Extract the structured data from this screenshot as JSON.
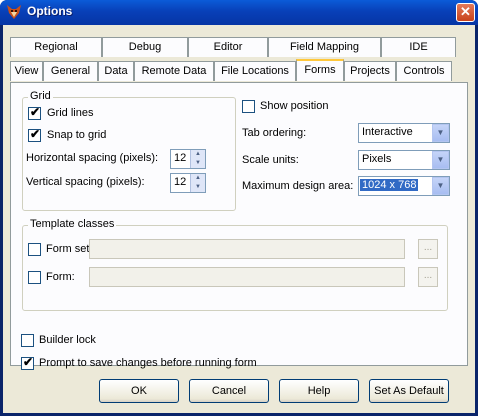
{
  "window": {
    "title": "Options",
    "close_glyph": "✕"
  },
  "tabs_row1": [
    "Regional",
    "Debug",
    "Editor",
    "Field Mapping",
    "IDE"
  ],
  "tabs_row2": [
    "View",
    "General",
    "Data",
    "Remote Data",
    "File Locations",
    "Forms",
    "Projects",
    "Controls"
  ],
  "active_tab": "Forms",
  "grid": {
    "label": "Grid",
    "grid_lines": {
      "label": "Grid lines",
      "checked": true
    },
    "snap_to_grid": {
      "label": "Snap to grid",
      "checked": true
    },
    "h_spacing": {
      "label": "Horizontal spacing (pixels):",
      "value": "12"
    },
    "v_spacing": {
      "label": "Vertical spacing (pixels):",
      "value": "12"
    }
  },
  "right": {
    "show_position": {
      "label": "Show position",
      "checked": false
    },
    "tab_ordering": {
      "label": "Tab ordering:",
      "value": "Interactive"
    },
    "scale_units": {
      "label": "Scale units:",
      "value": "Pixels"
    },
    "max_design_area": {
      "label": "Maximum design area:",
      "value": "1024 x 768"
    }
  },
  "template": {
    "label": "Template classes",
    "form_set": {
      "label": "Form set:",
      "checked": false,
      "value": ""
    },
    "form": {
      "label": "Form:",
      "checked": false,
      "value": ""
    },
    "ellipsis": "..."
  },
  "builder_lock": {
    "label": "Builder lock",
    "checked": false
  },
  "prompt_save": {
    "label": "Prompt to save changes before running form",
    "checked": true
  },
  "buttons": {
    "ok": "OK",
    "cancel": "Cancel",
    "help": "Help",
    "set_default": "Set As Default"
  },
  "check_glyph": "✔",
  "icons": {
    "app": "fox-head-icon",
    "spin_up": "▲",
    "spin_down": "▼",
    "dropdown": "▼"
  }
}
